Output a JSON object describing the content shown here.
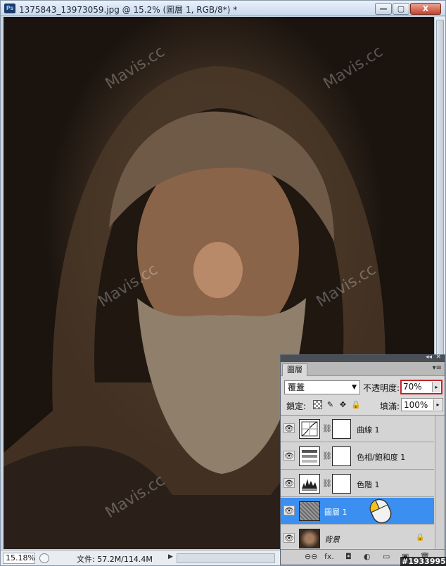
{
  "window": {
    "title": "1375843_13973059.jpg @ 15.2% (圖層 1, RGB/8*) *",
    "logo": "Ps",
    "minimize": "—",
    "maximize": "▢",
    "close": "X"
  },
  "canvas": {
    "watermark": "Mavis.cc",
    "description_icon": "photo-canvas"
  },
  "status": {
    "zoom": "15.18%",
    "file_info": "文件: 57.2M/114.4M",
    "arrow": "▶"
  },
  "layers_panel": {
    "tab": "圖層",
    "collapse": "◂◂",
    "close": "✕",
    "menu": "▾≡",
    "blend_mode": "覆蓋",
    "blend_arrow": "▼",
    "opacity_label": "不透明度:",
    "opacity_value": "70%",
    "lock_label": "鎖定:",
    "fill_label": "填滿:",
    "fill_value": "100%",
    "spin_arrow": "▸",
    "layers": [
      {
        "name": "曲線 1",
        "type": "adjustment",
        "thumb_icon": "curves-icon",
        "selected": false
      },
      {
        "name": "色相/飽和度 1",
        "type": "adjustment",
        "thumb_icon": "hue-saturation-icon",
        "selected": false
      },
      {
        "name": "色階 1",
        "type": "adjustment",
        "thumb_icon": "levels-icon",
        "selected": false
      },
      {
        "name": "圖層 1",
        "type": "pixel",
        "thumb_icon": "texture-thumbnail",
        "selected": true
      },
      {
        "name": "背景",
        "type": "background",
        "thumb_icon": "portrait-thumbnail",
        "selected": false,
        "locked": true
      }
    ],
    "footer": {
      "link": "⊖⊖",
      "fx": "fx.",
      "mask": "◘",
      "adjust": "◐",
      "group": "▭",
      "new": "▣",
      "delete": "🗑"
    }
  },
  "overlay_id": "#1933995",
  "colors": {
    "selected_row": "#3b8ff0",
    "opacity_highlight": "#c0272d"
  }
}
